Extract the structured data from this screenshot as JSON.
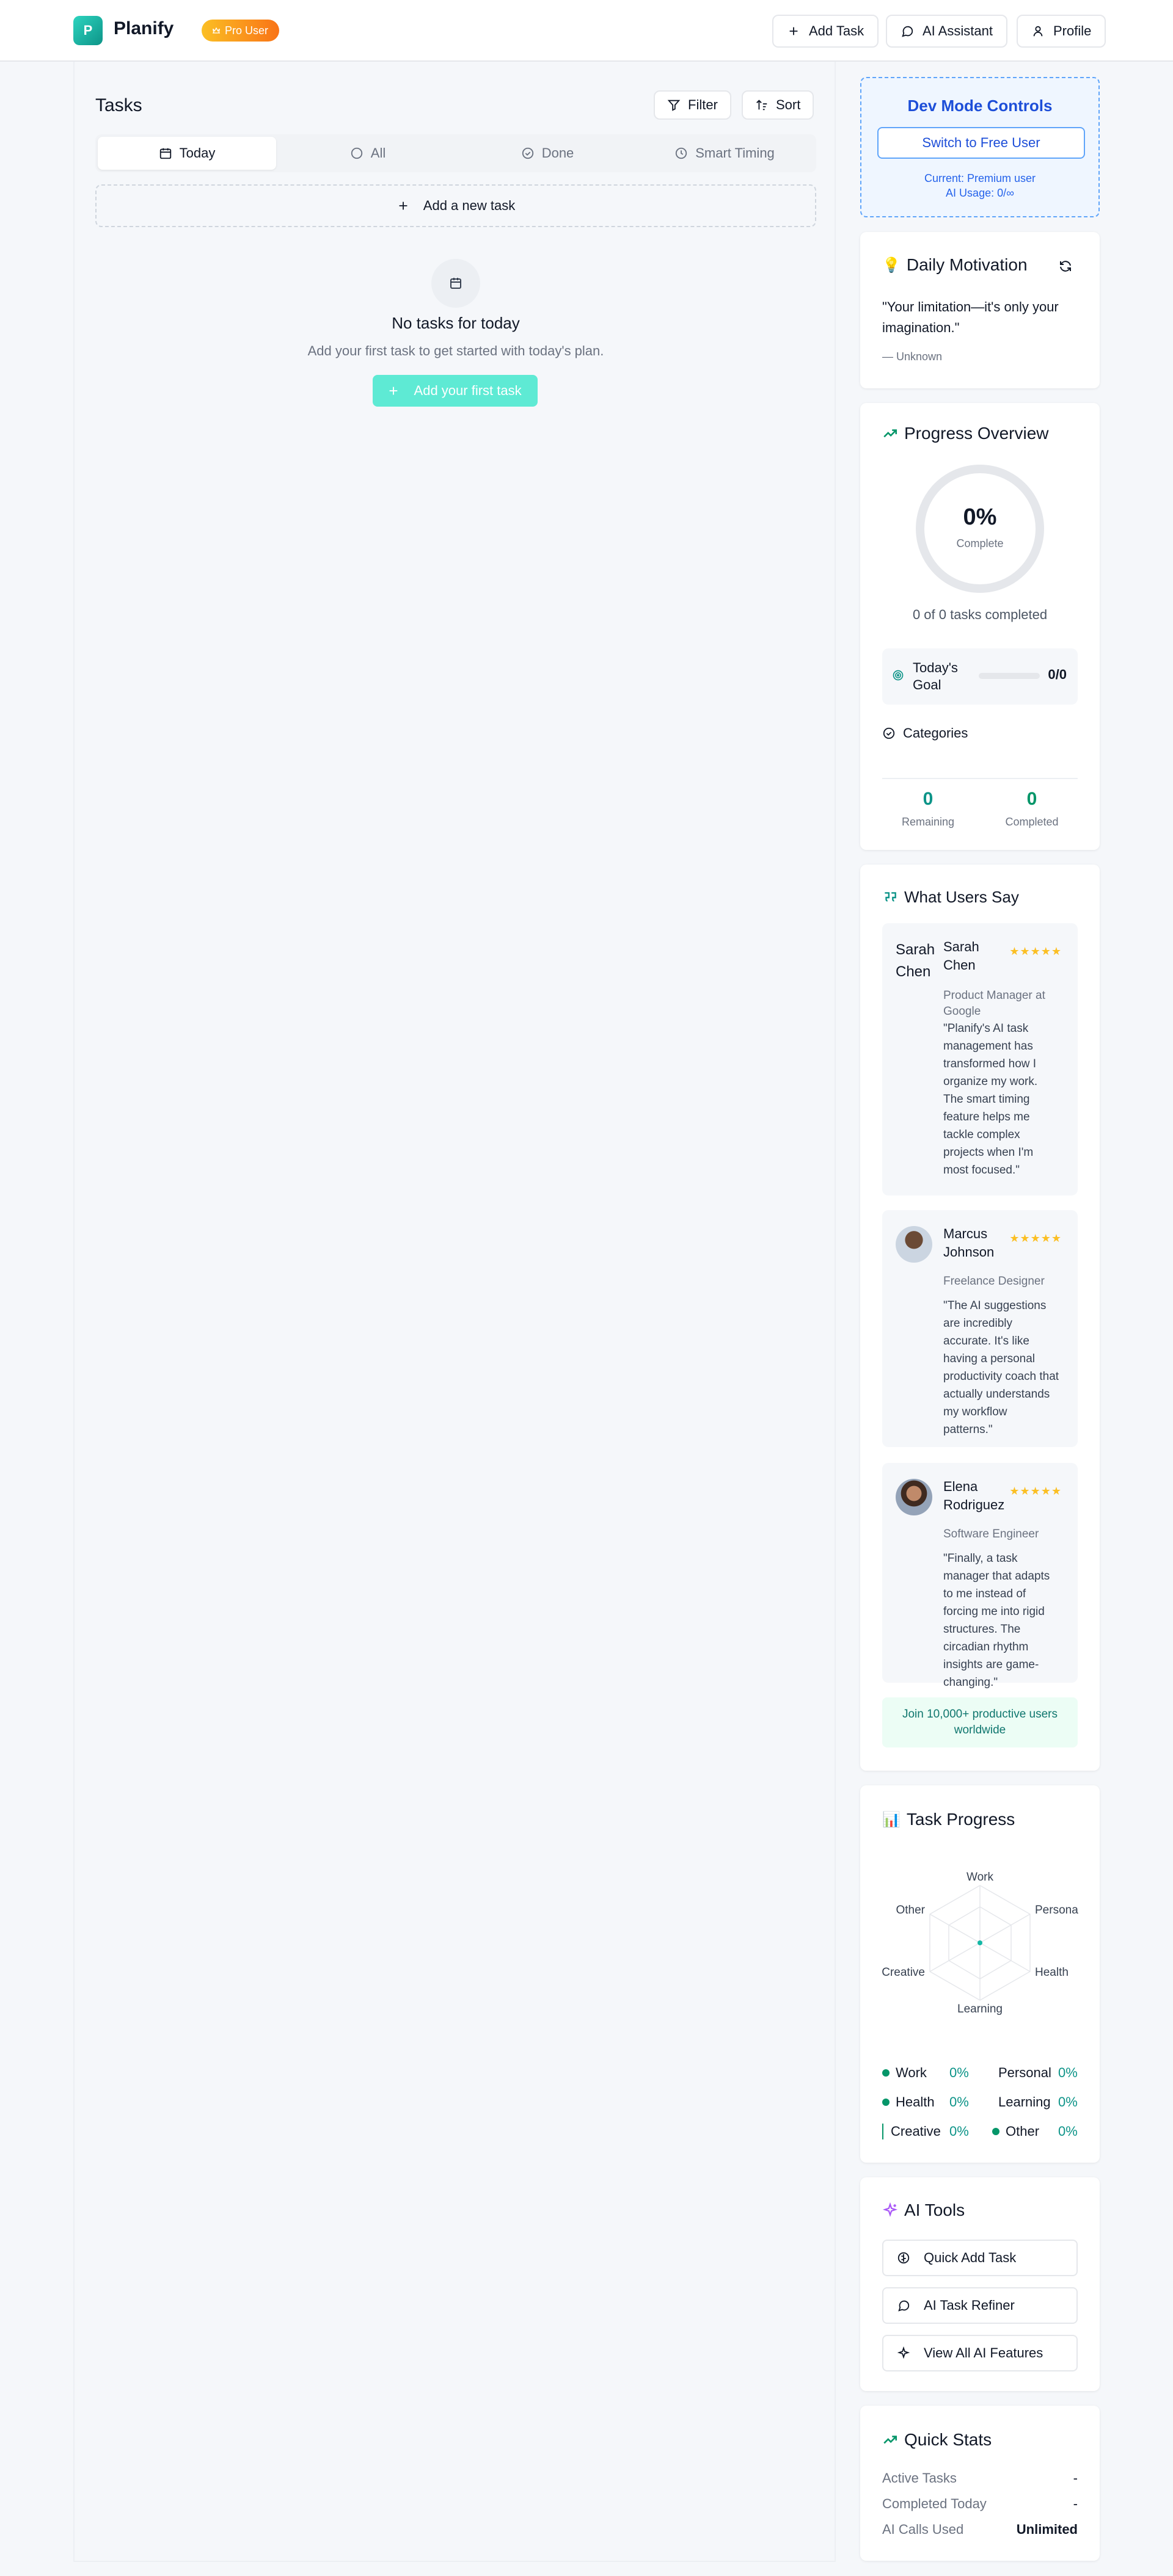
{
  "header": {
    "logo_letter": "P",
    "app_name": "Planify",
    "pro_badge": "Pro User",
    "add_task": "Add Task",
    "ai_assistant": "AI Assistant",
    "profile": "Profile"
  },
  "tasks": {
    "title": "Tasks",
    "filter": "Filter",
    "sort": "Sort",
    "tabs": [
      "Today",
      "All",
      "Done",
      "Smart Timing"
    ],
    "add_new": "Add a new task",
    "empty_title": "No tasks for today",
    "empty_sub": "Add your first task to get started with today's plan.",
    "add_first": "Add your first task"
  },
  "dev": {
    "title": "Dev Mode Controls",
    "button": "Switch to Free User",
    "current": "Current: Premium user",
    "usage": "AI Usage: 0/∞"
  },
  "motivation": {
    "title": "Daily Motivation",
    "quote": "\"Your limitation—it's only your imagination.\"",
    "author": "— Unknown"
  },
  "progress": {
    "title": "Progress Overview",
    "percent": "0%",
    "complete": "Complete",
    "summary": "0 of 0 tasks completed",
    "goal_label": "Today's Goal",
    "goal_value": "0/0",
    "goal_fraction": 0,
    "categories": "Categories",
    "remaining_value": "0",
    "remaining_label": "Remaining",
    "completed_value": "0",
    "completed_label": "Completed"
  },
  "testimonials": {
    "title": "What Users Say",
    "stars": "★★★★★",
    "items": [
      {
        "name": "Sarah Chen",
        "avatar_alt": "Sarah Chen",
        "role": "Product Manager at Google",
        "quote": "\"Planify's AI task management has transformed how I organize my work. The smart timing feature helps me tackle complex projects when I'm most focused.\""
      },
      {
        "name": "Marcus Johnson",
        "role": "Freelance Designer",
        "quote": "\"The AI suggestions are incredibly accurate. It's like having a personal productivity coach that actually understands my workflow patterns.\""
      },
      {
        "name": "Elena Rodriguez",
        "role": "Software Engineer",
        "quote": "\"Finally, a task manager that adapts to me instead of forcing me into rigid structures. The circadian rhythm insights are game-changing.\""
      }
    ],
    "join": "Join 10,000+ productive users worldwide"
  },
  "task_progress": {
    "title": "Task Progress",
    "radar_labels": [
      "Work",
      "Persona",
      "Health",
      "Learning",
      "Creative",
      "Other"
    ],
    "legend": [
      {
        "label": "Work",
        "pct": "0%"
      },
      {
        "label": "Personal",
        "pct": "0%"
      },
      {
        "label": "Health",
        "pct": "0%"
      },
      {
        "label": "Learning",
        "pct": "0%"
      },
      {
        "label": "Creative",
        "pct": "0%"
      },
      {
        "label": "Other",
        "pct": "0%"
      }
    ]
  },
  "ai_tools": {
    "title": "AI Tools",
    "quick_add": "Quick Add Task",
    "refiner": "AI Task Refiner",
    "view_all": "View All AI Features"
  },
  "quick_stats": {
    "title": "Quick Stats",
    "rows": [
      {
        "label": "Active Tasks",
        "value": "-"
      },
      {
        "label": "Completed Today",
        "value": "-"
      },
      {
        "label": "AI Calls Used",
        "value": "Unlimited"
      }
    ]
  },
  "colors": {
    "brand": "#14b8a6",
    "accent_green": "#059669",
    "dev_blue": "#1d4ed8",
    "star": "#fbbf24"
  }
}
